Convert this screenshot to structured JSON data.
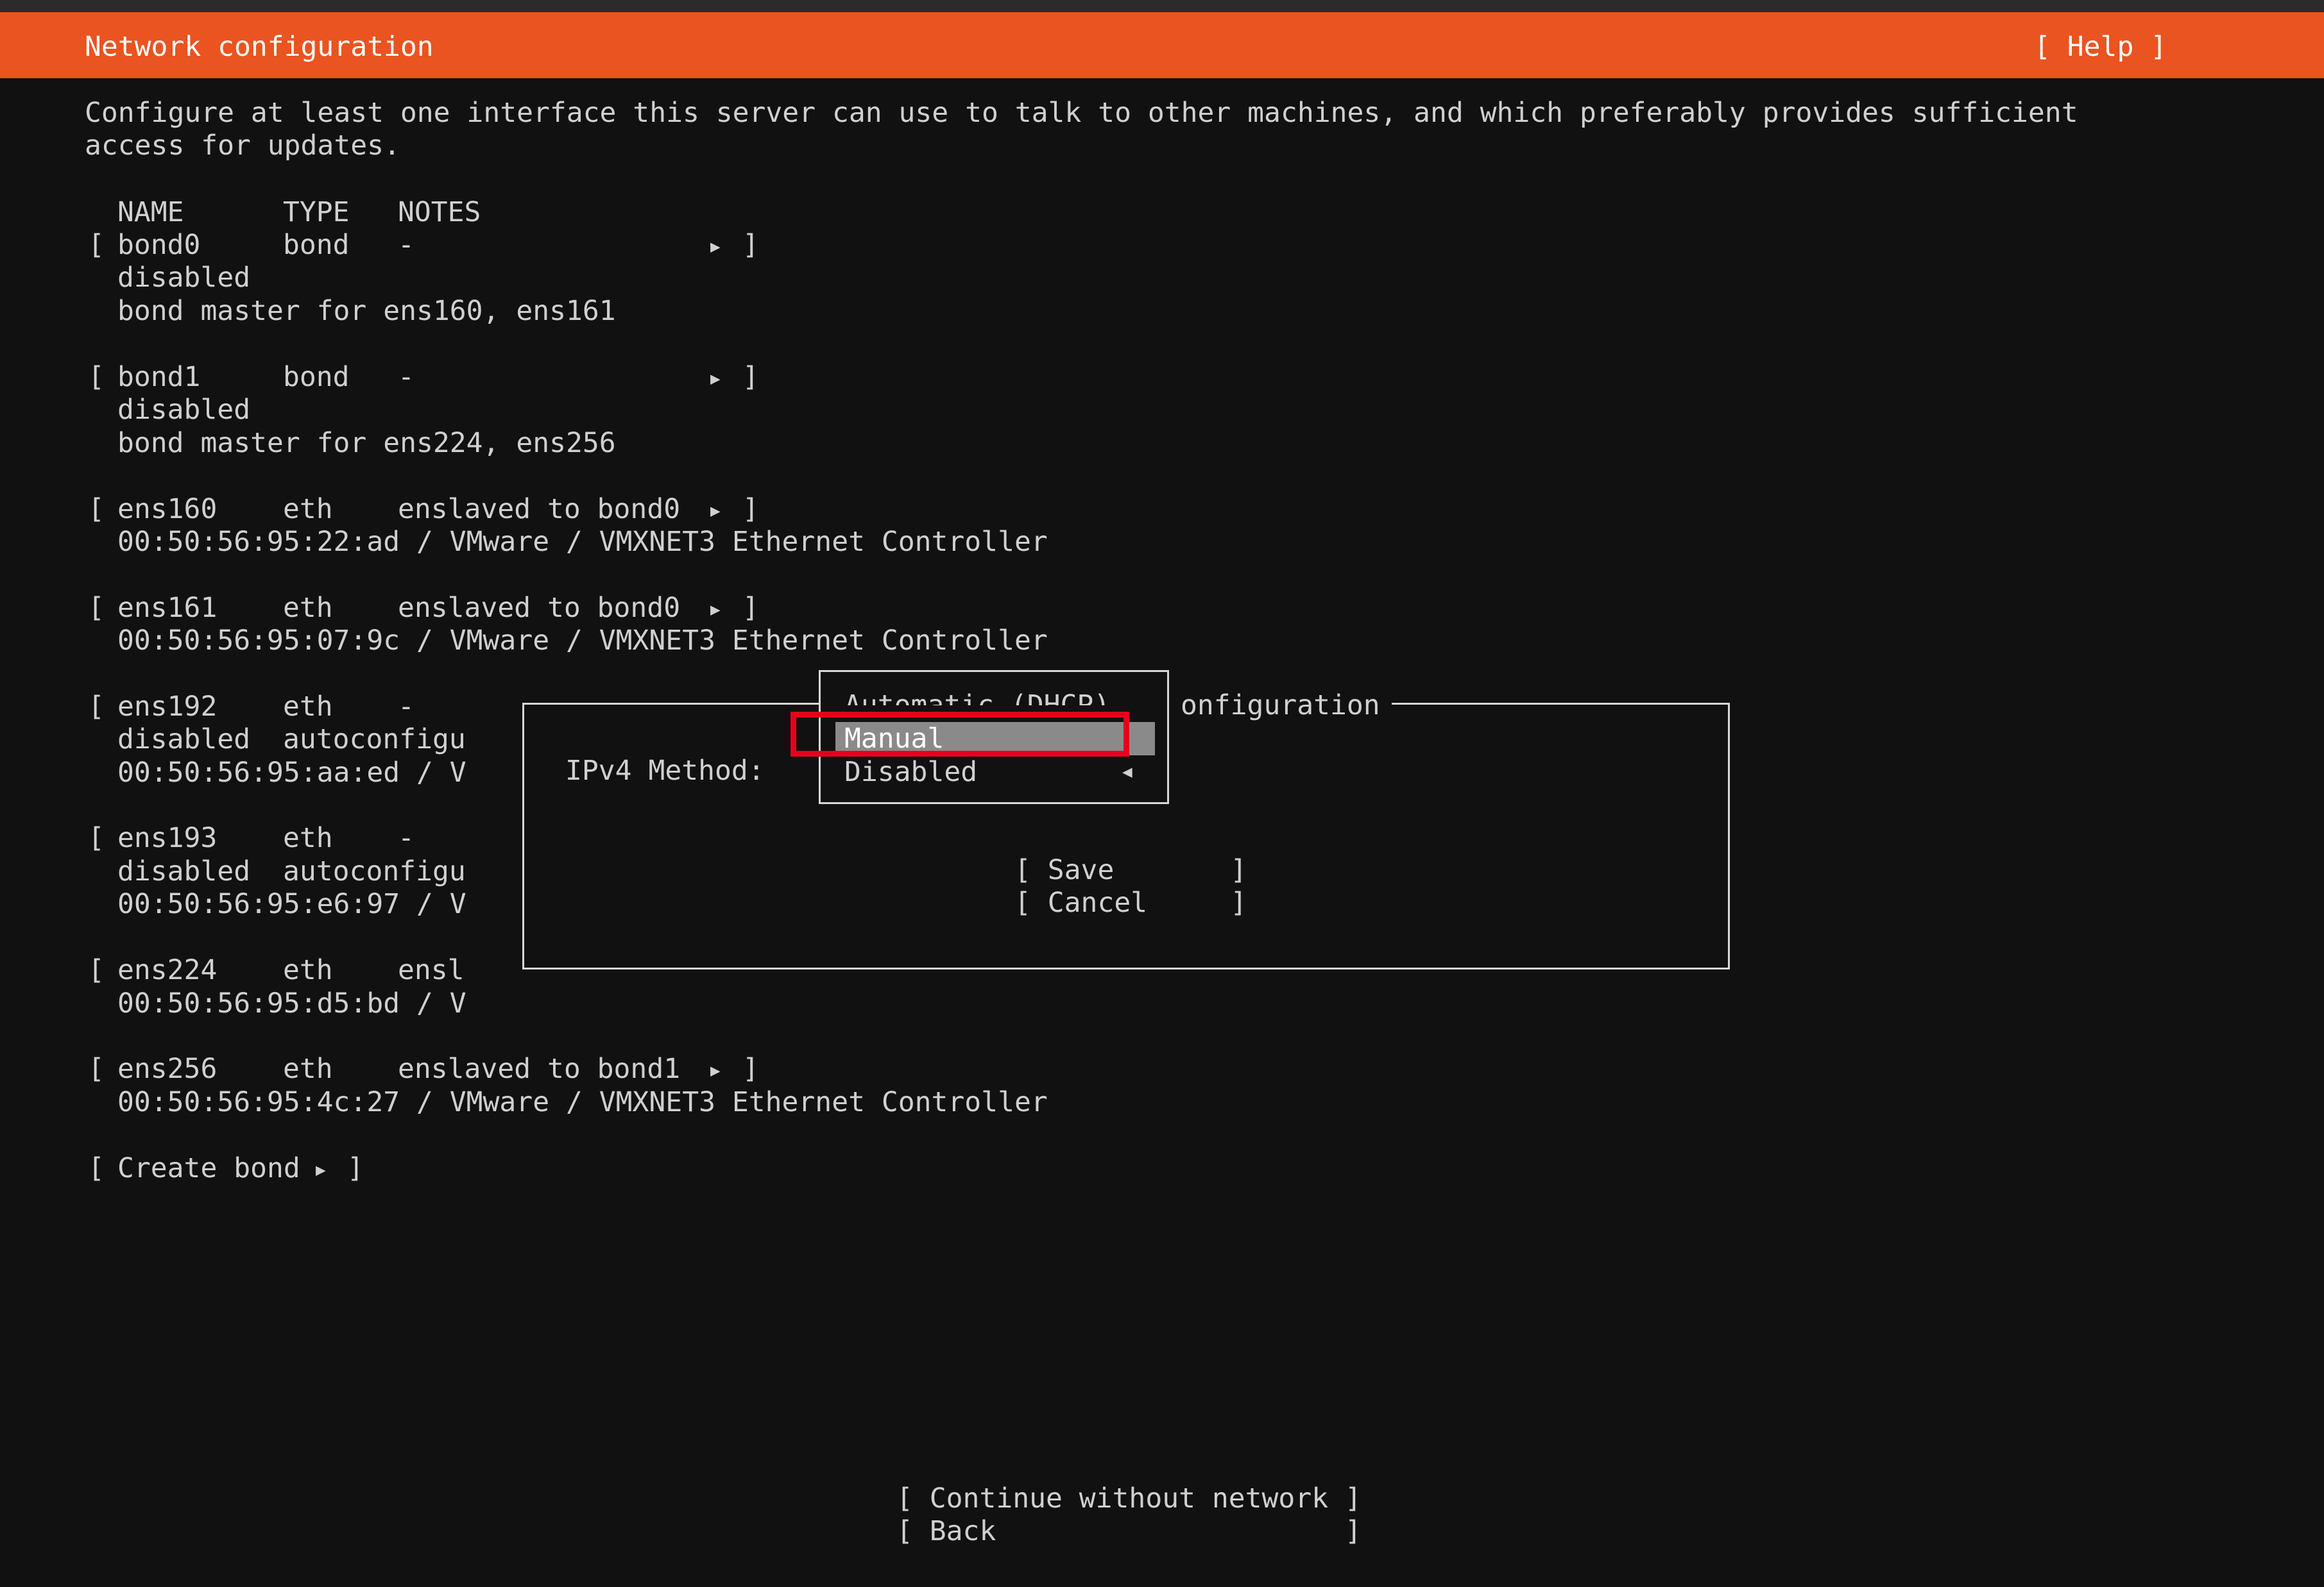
{
  "header": {
    "title": "Network configuration",
    "help_label": "[ Help ]"
  },
  "intro": {
    "line1": "Configure at least one interface this server can use to talk to other machines, and which preferably provides sufficient",
    "line2": "access for updates."
  },
  "table": {
    "headers": {
      "name": "NAME",
      "type": "TYPE",
      "notes": "NOTES"
    },
    "rows": {
      "bond0": {
        "open": "[",
        "name": "bond0",
        "type": "bond",
        "notes": "-",
        "close": "]",
        "status": "disabled",
        "detail": "bond master for ens160, ens161"
      },
      "bond1": {
        "open": "[",
        "name": "bond1",
        "type": "bond",
        "notes": "-",
        "close": "]",
        "status": "disabled",
        "detail": "bond master for ens224, ens256"
      },
      "ens160": {
        "open": "[",
        "name": "ens160",
        "type": "eth",
        "notes": "enslaved to bond0",
        "close": "]",
        "detail": "00:50:56:95:22:ad / VMware / VMXNET3 Ethernet Controller"
      },
      "ens161": {
        "open": "[",
        "name": "ens161",
        "type": "eth",
        "notes": "enslaved to bond0",
        "close": "]",
        "detail": "00:50:56:95:07:9c / VMware / VMXNET3 Ethernet Controller"
      },
      "ens192": {
        "open": "[",
        "name": "ens192",
        "type": "eth",
        "notes": "-",
        "status": "disabled",
        "status_note": "autoconfigu",
        "detail": "00:50:56:95:aa:ed / V"
      },
      "ens193": {
        "open": "[",
        "name": "ens193",
        "type": "eth",
        "notes": "-",
        "status": "disabled",
        "status_note": "autoconfigu",
        "detail": "00:50:56:95:e6:97 / V"
      },
      "ens224": {
        "open": "[",
        "name": "ens224",
        "type": "eth",
        "notes": "ensl",
        "detail": "00:50:56:95:d5:bd / V"
      },
      "ens256": {
        "open": "[",
        "name": "ens256",
        "type": "eth",
        "notes": "enslaved to bond1",
        "close": "]",
        "detail": "00:50:56:95:4c:27 / VMware / VMXNET3 Ethernet Controller"
      }
    }
  },
  "create_bond": {
    "open": "[",
    "label": "Create bond",
    "close": "]"
  },
  "dialog": {
    "title_visible": "onfiguration",
    "ipv4_label": "IPv4 Method:",
    "save_label": "[ Save       ]",
    "cancel_label": "[ Cancel     ]"
  },
  "dropdown": {
    "options": [
      "Automatic (DHCP)",
      "Manual",
      "Disabled"
    ],
    "selected": "Manual"
  },
  "footer": {
    "continue_label": "[ Continue without network ]",
    "back_label": "[ Back                     ]"
  },
  "colors": {
    "header_bg": "#e95420",
    "background": "#111111",
    "text": "#d0d0d0",
    "selected_bg": "#8a8a8a",
    "highlight": "#e8001c"
  },
  "icons": {
    "row_arrow": "triangle-right-icon",
    "dropdown_arrow": "triangle-left-icon"
  }
}
